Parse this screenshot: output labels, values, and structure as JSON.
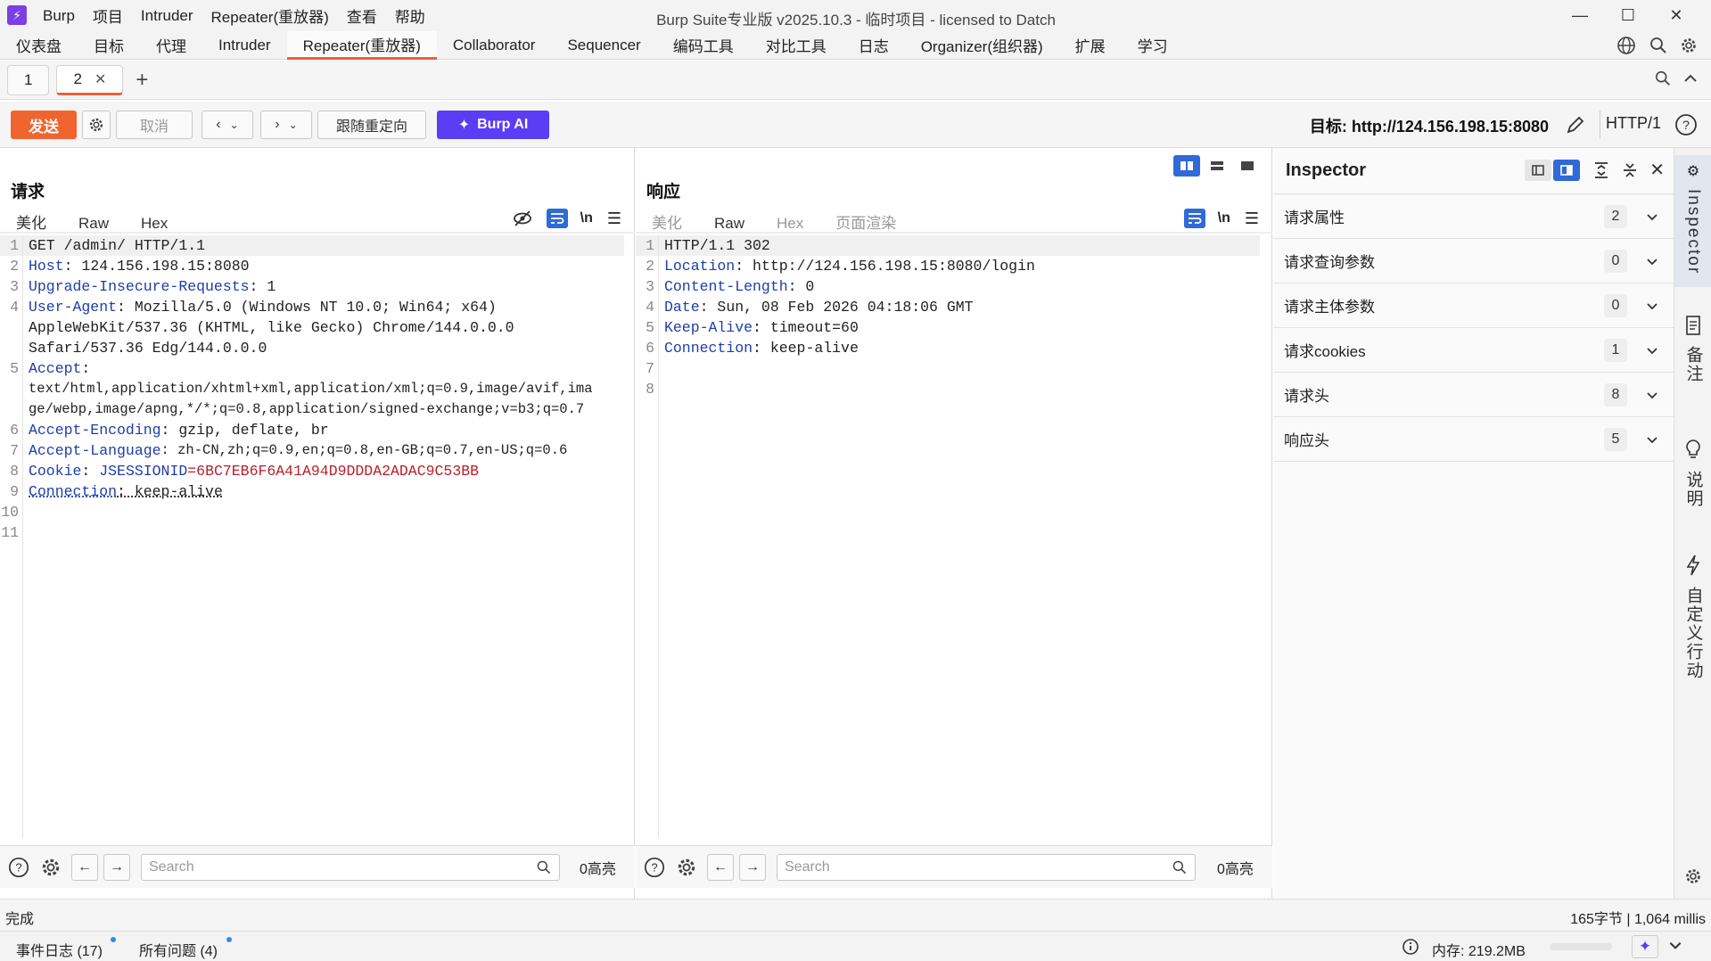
{
  "titlebar": {
    "menu": [
      "Burp",
      "项目",
      "Intruder",
      "Repeater(重放器)",
      "查看",
      "帮助"
    ],
    "title": "Burp Suite专业版  v2025.10.3 - 临时项目 - licensed to Datch"
  },
  "module_tabs": [
    "仪表盘",
    "目标",
    "代理",
    "Intruder",
    "Repeater(重放器)",
    "Collaborator",
    "Sequencer",
    "编码工具",
    "对比工具",
    "日志",
    "Organizer(组织器)",
    "扩展",
    "学习"
  ],
  "repeater_tabs": [
    {
      "label": "1"
    },
    {
      "label": "2"
    }
  ],
  "toolbar": {
    "send_label": "发送",
    "cancel_label": "取消",
    "follow_redirect_label": "跟随重定向",
    "burp_ai_label": "Burp AI",
    "target_label": "目标: http://124.156.198.15:8080",
    "http_version": "HTTP/1"
  },
  "request": {
    "title": "请求",
    "tabs": [
      "美化",
      "Raw",
      "Hex"
    ],
    "lines": [
      {
        "n": "1",
        "key": "",
        "text": "GET /admin/ HTTP/1.1"
      },
      {
        "n": "2",
        "key": "Host",
        "text": ": 124.156.198.15:8080"
      },
      {
        "n": "3",
        "key": "Upgrade-Insecure-Requests",
        "text": ": 1"
      },
      {
        "n": "4",
        "key": "User-Agent",
        "text": ": Mozilla/5.0 (Windows NT 10.0; Win64; x64)"
      },
      {
        "n": "",
        "key": "",
        "text": "AppleWebKit/537.36 (KHTML, like Gecko) Chrome/144.0.0.0"
      },
      {
        "n": "",
        "key": "",
        "text": "Safari/537.36 Edg/144.0.0.0"
      },
      {
        "n": "5",
        "key": "Accept",
        "text": ":"
      },
      {
        "n": "",
        "key": "",
        "text": "text/html,application/xhtml+xml,application/xml;q=0.9,image/avif,ima"
      },
      {
        "n": "",
        "key": "",
        "text": "ge/webp,image/apng,*/*;q=0.8,application/signed-exchange;v=b3;q=0.7"
      },
      {
        "n": "6",
        "key": "Accept-Encoding",
        "text": ": gzip, deflate, br"
      },
      {
        "n": "7",
        "key": "Accept-Language",
        "text": ": zh-CN,zh;q=0.9,en;q=0.8,en-GB;q=0.7,en-US;q=0.6"
      },
      {
        "n": "8",
        "key": "Cookie",
        "text": ": ",
        "cookie_name": "JSESSIONID",
        "cookie_value": "=6BC7EB6F6A41A94D9DDDA2ADAC9C53BB"
      },
      {
        "n": "9",
        "key": "Connection",
        "text": ": keep-alive"
      },
      {
        "n": "10",
        "key": "",
        "text": ""
      },
      {
        "n": "11",
        "key": "",
        "text": ""
      }
    ],
    "search_placeholder": "Search",
    "highlight_count": "0高亮"
  },
  "response": {
    "title": "响应",
    "tabs": [
      "美化",
      "Raw",
      "Hex",
      "页面渲染"
    ],
    "lines": [
      {
        "n": "1",
        "key": "",
        "text": "HTTP/1.1 302"
      },
      {
        "n": "2",
        "key": "Location",
        "text": ": http://124.156.198.15:8080/login"
      },
      {
        "n": "3",
        "key": "Content-Length",
        "text": ": 0"
      },
      {
        "n": "4",
        "key": "Date",
        "text": ": Sun, 08 Feb 2026 04:18:06 GMT"
      },
      {
        "n": "5",
        "key": "Keep-Alive",
        "text": ": timeout=60"
      },
      {
        "n": "6",
        "key": "Connection",
        "text": ": keep-alive"
      },
      {
        "n": "7",
        "key": "",
        "text": ""
      },
      {
        "n": "8",
        "key": "",
        "text": ""
      }
    ],
    "search_placeholder": "Search",
    "highlight_count": "0高亮"
  },
  "inspector": {
    "title": "Inspector",
    "rows": [
      {
        "label": "请求属性",
        "count": "2"
      },
      {
        "label": "请求查询参数",
        "count": "0"
      },
      {
        "label": "请求主体参数",
        "count": "0"
      },
      {
        "label": "请求cookies",
        "count": "1"
      },
      {
        "label": "请求头",
        "count": "8"
      },
      {
        "label": "响应头",
        "count": "5"
      }
    ]
  },
  "side_strip": [
    "Inspector",
    "备注",
    "说明",
    "自定义行动"
  ],
  "status": {
    "left": "完成",
    "right": "165字节 | 1,064 millis",
    "event_log": "事件日志 (17)",
    "all_issues": "所有问题 (4)",
    "memory": "内存: 219.2MB"
  },
  "colors": {
    "accent": "#e8623a",
    "send": "#f06430",
    "burp_ai": "#5b3df5",
    "header_key": "#1e3ea8",
    "cookie_value": "#b8202a"
  }
}
